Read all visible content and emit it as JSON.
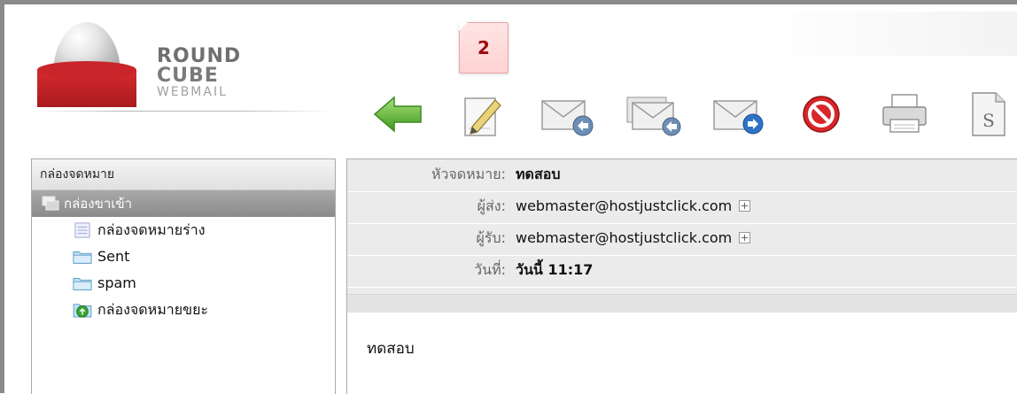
{
  "logo": {
    "line1": "ROUND",
    "line2": "CUBE",
    "line3": "WEBMAIL"
  },
  "badge": {
    "value": "2"
  },
  "toolbar": {
    "buttons": [
      {
        "name": "back",
        "icon": "back-arrow-icon"
      },
      {
        "name": "compose",
        "icon": "compose-pencil-icon"
      },
      {
        "name": "reply",
        "icon": "reply-icon"
      },
      {
        "name": "reply-all",
        "icon": "reply-all-icon"
      },
      {
        "name": "forward",
        "icon": "forward-icon"
      },
      {
        "name": "delete",
        "icon": "delete-icon"
      },
      {
        "name": "print",
        "icon": "print-icon"
      },
      {
        "name": "source",
        "icon": "source-icon"
      }
    ]
  },
  "folders": {
    "title": "กล่องจดหมาย",
    "items": [
      {
        "label": "กล่องขาเข้า",
        "icon": "inbox-icon",
        "selected": true
      },
      {
        "label": "กล่องจดหมายร่าง",
        "icon": "drafts-icon"
      },
      {
        "label": "Sent",
        "icon": "folder-icon"
      },
      {
        "label": "spam",
        "icon": "folder-icon"
      },
      {
        "label": "กล่องจดหมายขยะ",
        "icon": "trash-icon"
      }
    ]
  },
  "message": {
    "subject_label": "หัวจดหมาย:",
    "subject": "ทดสอบ",
    "from_label": "ผู้ส่ง:",
    "from": "webmaster@hostjustclick.com",
    "to_label": "ผู้รับ:",
    "to": "webmaster@hostjustclick.com",
    "date_label": "วันที่:",
    "date": "วันนี้ 11:17",
    "body": "ทดสอบ"
  },
  "colors": {
    "accent_red": "#c8262a",
    "badge_text": "#9b0a0a",
    "selected_row": "#999999"
  }
}
